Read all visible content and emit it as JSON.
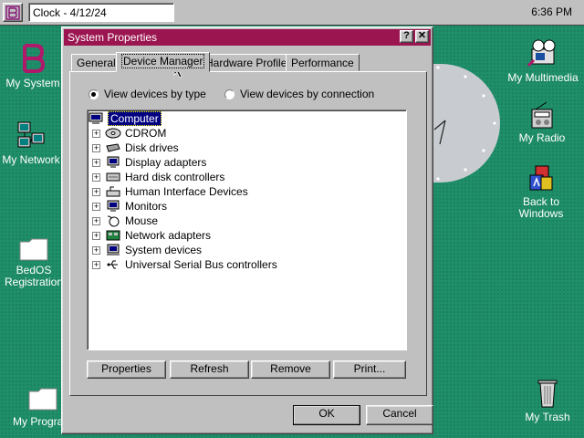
{
  "taskbar": {
    "task_label": "Clock - 4/12/24",
    "clock": "6:36 PM"
  },
  "desktop": {
    "left_icons": [
      {
        "label": "My System"
      },
      {
        "label": "My Network"
      },
      {
        "label": "BedOS\nRegistration"
      },
      {
        "label": "My Progra"
      }
    ],
    "right_icons": [
      {
        "label": "My Multimedia"
      },
      {
        "label": "My Radio"
      },
      {
        "label": "Back to\nWindows"
      },
      {
        "label": "My Trash"
      }
    ]
  },
  "window": {
    "title": "System Properties",
    "help_label": "?",
    "close_label": "✕",
    "tabs": [
      {
        "label": "General"
      },
      {
        "label": "Device Manager"
      },
      {
        "label": "Hardware Profiles"
      },
      {
        "label": "Performance"
      }
    ],
    "active_tab": "Device Manager",
    "radio_by_type": "View devices by type",
    "radio_by_connection": "View devices by connection",
    "selected_view": "type",
    "tree": {
      "root": "Computer",
      "items": [
        {
          "label": "CDROM",
          "icon": "cdrom-icon"
        },
        {
          "label": "Disk drives",
          "icon": "disk-drive-icon"
        },
        {
          "label": "Display adapters",
          "icon": "display-adapter-icon"
        },
        {
          "label": "Hard disk controllers",
          "icon": "hard-disk-controller-icon"
        },
        {
          "label": "Human Interface Devices",
          "icon": "hid-icon"
        },
        {
          "label": "Monitors",
          "icon": "monitor-icon"
        },
        {
          "label": "Mouse",
          "icon": "mouse-icon"
        },
        {
          "label": "Network adapters",
          "icon": "network-adapter-icon"
        },
        {
          "label": "System devices",
          "icon": "system-device-icon"
        },
        {
          "label": "Universal Serial Bus controllers",
          "icon": "usb-icon"
        }
      ]
    },
    "buttons": {
      "properties": "Properties",
      "refresh": "Refresh",
      "remove": "Remove",
      "print": "Print...",
      "ok": "OK",
      "cancel": "Cancel"
    }
  },
  "colors": {
    "desktop": "#1f8f6a",
    "titlebar": "#9b1550",
    "selection": "#000080"
  }
}
